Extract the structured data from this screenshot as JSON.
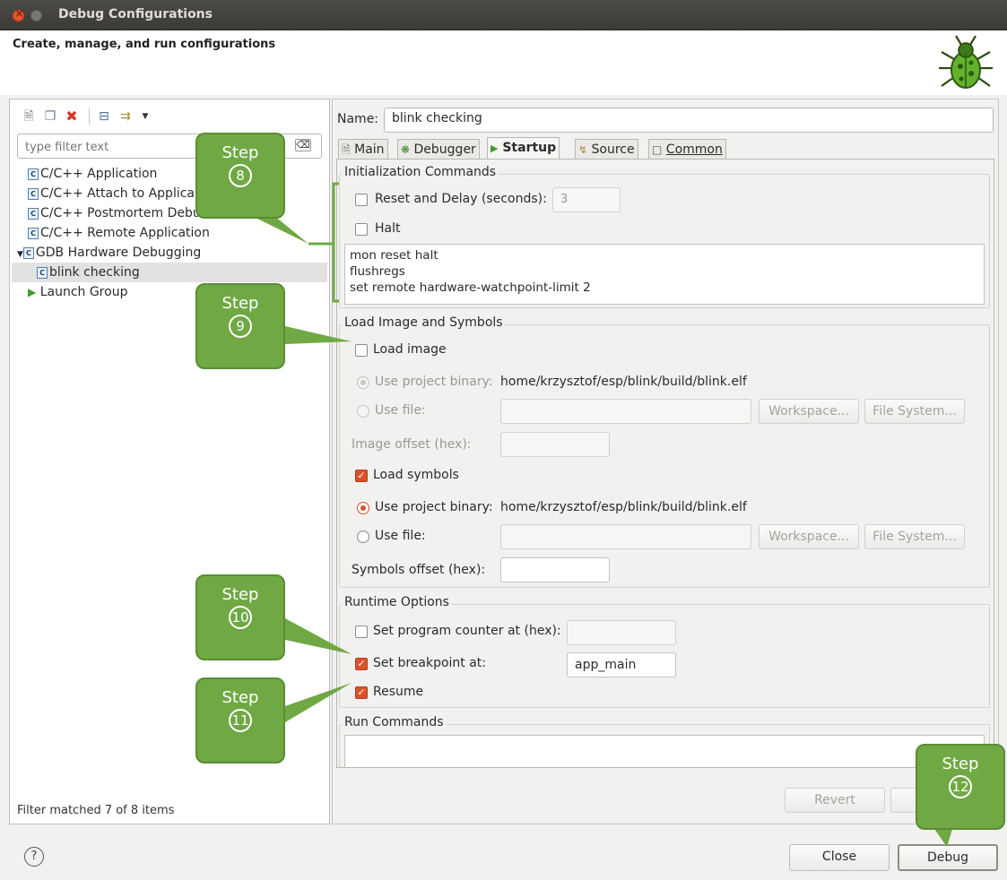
{
  "window": {
    "title": "Debug Configurations"
  },
  "header": {
    "subtitle": "Create, manage, and run configurations"
  },
  "left_panel": {
    "filter_placeholder": "type filter text",
    "tree": [
      {
        "label": "C/C++ Application",
        "icon": "c-config-icon",
        "level": 0
      },
      {
        "label": "C/C++ Attach to Applica",
        "icon": "c-config-icon",
        "level": 0
      },
      {
        "label": "C/C++ Postmortem Debu",
        "icon": "c-config-icon",
        "level": 0
      },
      {
        "label": "C/C++ Remote Application",
        "icon": "c-config-icon",
        "level": 0
      },
      {
        "label": "GDB Hardware Debugging",
        "icon": "c-config-icon",
        "level": 0,
        "expanded": true
      },
      {
        "label": "blink checking",
        "icon": "c-config-icon",
        "level": 1,
        "selected": true
      },
      {
        "label": "Launch Group",
        "icon": "launch-icon",
        "level": 0
      }
    ],
    "filter_status": "Filter matched 7 of 8 items"
  },
  "right_panel": {
    "name_label": "Name:",
    "name_value": "blink checking",
    "tabs": [
      {
        "label": "Main",
        "icon": "doc-icon",
        "active": false
      },
      {
        "label": "Debugger",
        "icon": "bug-tab-icon",
        "active": false
      },
      {
        "label": "Startup",
        "icon": "play-icon",
        "active": true
      },
      {
        "label": "Source",
        "icon": "source-icon",
        "active": false
      },
      {
        "label": "Common",
        "icon": "common-icon",
        "active": false
      }
    ],
    "init_commands": {
      "title": "Initialization Commands",
      "reset_label": "Reset and Delay (seconds):",
      "reset_checked": false,
      "reset_value": "3",
      "halt_label": "Halt",
      "halt_checked": false,
      "commands": [
        "mon reset halt",
        "flushregs",
        "set remote hardware-watchpoint-limit 2"
      ]
    },
    "load_image": {
      "title": "Load Image and Symbols",
      "load_image_label": "Load image",
      "load_image_checked": false,
      "use_project_binary_label": "Use project binary:",
      "image_binary_path": "home/krzysztof/esp/blink/build/blink.elf",
      "use_file_label": "Use file:",
      "workspace_label": "Workspace...",
      "file_system_label": "File System...",
      "image_offset_label": "Image offset (hex):",
      "load_symbols_label": "Load symbols",
      "load_symbols_checked": true,
      "symbols_binary_path": "home/krzysztof/esp/blink/build/blink.elf",
      "symbols_offset_label": "Symbols offset (hex):"
    },
    "runtime": {
      "title": "Runtime Options",
      "set_pc_label": "Set program counter at (hex):",
      "set_pc_checked": false,
      "set_breakpoint_label": "Set breakpoint at:",
      "set_breakpoint_checked": true,
      "breakpoint_value": "app_main",
      "resume_label": "Resume",
      "resume_checked": true
    },
    "run_commands": {
      "title": "Run Commands"
    },
    "revert_label": "Revert",
    "apply_label": ""
  },
  "footer": {
    "help_symbol": "?",
    "close_label": "Close",
    "debug_label": "Debug"
  },
  "callouts": [
    {
      "step": "Step",
      "number": "8"
    },
    {
      "step": "Step",
      "number": "9"
    },
    {
      "step": "Step",
      "number": "10"
    },
    {
      "step": "Step",
      "number": "11"
    },
    {
      "step": "Step",
      "number": "12"
    }
  ],
  "colors": {
    "accent_orange": "#d9532c",
    "callout_green": "#70a844",
    "titlebar": "#3f3e3a"
  }
}
